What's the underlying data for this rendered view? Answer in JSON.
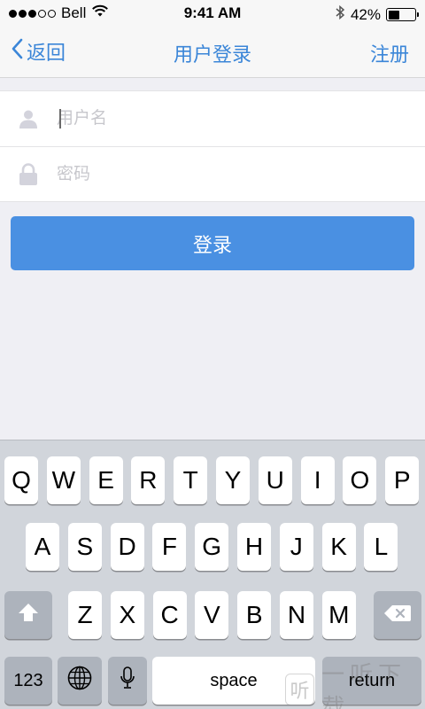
{
  "status_bar": {
    "carrier": "Bell",
    "time": "9:41 AM",
    "battery_percent": "42%",
    "battery_level": 0.42,
    "signal_filled": 3,
    "signal_total": 5,
    "icons": [
      "signal-dots",
      "wifi-icon",
      "bluetooth-icon",
      "battery-icon"
    ]
  },
  "navbar": {
    "back_label": "返回",
    "title": "用户登录",
    "right_label": "注册"
  },
  "form": {
    "username": {
      "value": "",
      "placeholder": "用户名",
      "icon": "user-icon"
    },
    "password": {
      "value": "",
      "placeholder": "密码",
      "icon": "lock-icon"
    }
  },
  "login_button": {
    "label": "登录"
  },
  "colors": {
    "accent": "#4a90e2",
    "nav_text": "#3b86d8",
    "background": "#efeff4",
    "keyboard_bg": "#d1d5db"
  },
  "keyboard": {
    "row1": [
      "Q",
      "W",
      "E",
      "R",
      "T",
      "Y",
      "U",
      "I",
      "O",
      "P"
    ],
    "row2": [
      "A",
      "S",
      "D",
      "F",
      "G",
      "H",
      "J",
      "K",
      "L"
    ],
    "row3": [
      "Z",
      "X",
      "C",
      "V",
      "B",
      "N",
      "M"
    ],
    "numbers_label": "123",
    "space_label": "space",
    "return_label": "return"
  },
  "watermark": {
    "mark": "听",
    "text": "一听下载"
  }
}
